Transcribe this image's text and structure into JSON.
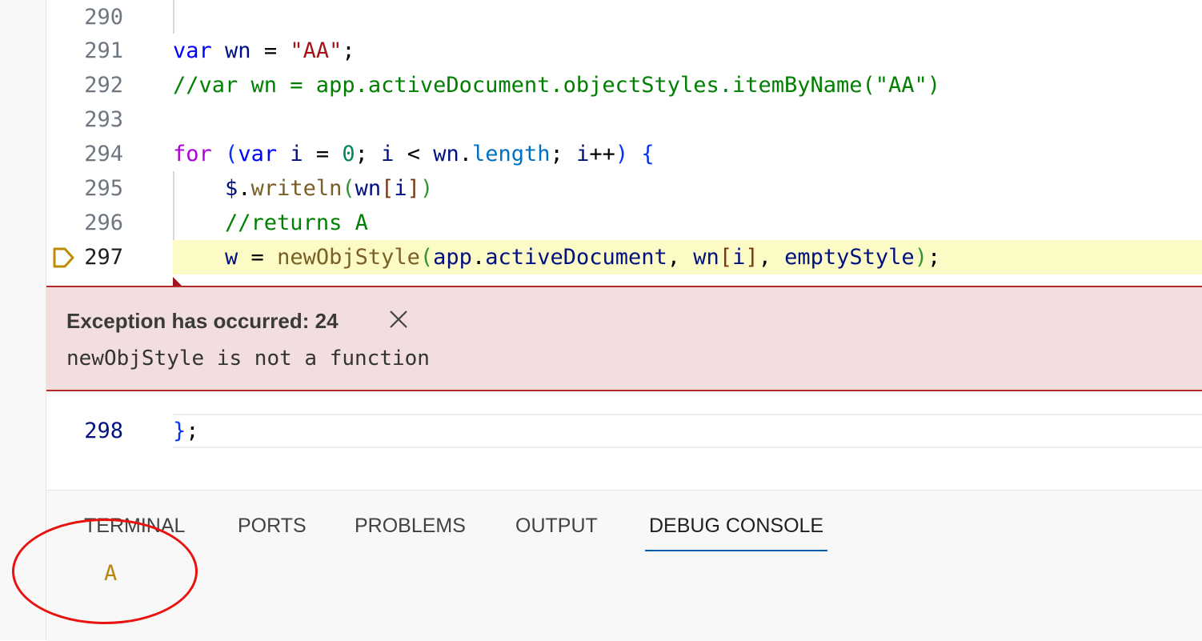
{
  "editor": {
    "lines": [
      {
        "number": "290",
        "tokens": []
      },
      {
        "number": "291",
        "tokens": [
          {
            "text": "var",
            "cls": "tk-kw"
          },
          {
            "text": " wn ",
            "cls": "tk-var"
          },
          {
            "text": "= ",
            "cls": "tk-op"
          },
          {
            "text": "\"AA\"",
            "cls": "tk-str"
          },
          {
            "text": ";",
            "cls": "tk-op"
          }
        ]
      },
      {
        "number": "292",
        "tokens": [
          {
            "text": "//var wn = app.activeDocument.objectStyles.itemByName(\"AA\")",
            "cls": "tk-com"
          }
        ]
      },
      {
        "number": "293",
        "tokens": []
      },
      {
        "number": "294",
        "tokens": [
          {
            "text": "for",
            "cls": "tk-ctl"
          },
          {
            "text": " ",
            "cls": "tk-op"
          },
          {
            "text": "(",
            "cls": "tk-p1"
          },
          {
            "text": "var",
            "cls": "tk-kw"
          },
          {
            "text": " i ",
            "cls": "tk-var"
          },
          {
            "text": "= ",
            "cls": "tk-op"
          },
          {
            "text": "0",
            "cls": "tk-num"
          },
          {
            "text": "; ",
            "cls": "tk-op"
          },
          {
            "text": "i",
            "cls": "tk-var"
          },
          {
            "text": " < ",
            "cls": "tk-op"
          },
          {
            "text": "wn",
            "cls": "tk-var"
          },
          {
            "text": ".",
            "cls": "tk-op"
          },
          {
            "text": "length",
            "cls": "tk-prop"
          },
          {
            "text": "; ",
            "cls": "tk-op"
          },
          {
            "text": "i",
            "cls": "tk-var"
          },
          {
            "text": "++",
            "cls": "tk-op"
          },
          {
            "text": ")",
            "cls": "tk-p1"
          },
          {
            "text": " ",
            "cls": "tk-op"
          },
          {
            "text": "{",
            "cls": "tk-p1"
          }
        ]
      },
      {
        "number": "295",
        "tokens": [
          {
            "text": "    ",
            "cls": "tk-op"
          },
          {
            "text": "$",
            "cls": "tk-var"
          },
          {
            "text": ".",
            "cls": "tk-op"
          },
          {
            "text": "writeln",
            "cls": "tk-fn"
          },
          {
            "text": "(",
            "cls": "tk-p2"
          },
          {
            "text": "wn",
            "cls": "tk-var"
          },
          {
            "text": "[",
            "cls": "tk-p3"
          },
          {
            "text": "i",
            "cls": "tk-var"
          },
          {
            "text": "]",
            "cls": "tk-p3"
          },
          {
            "text": ")",
            "cls": "tk-p2"
          }
        ]
      },
      {
        "number": "296",
        "tokens": [
          {
            "text": "    ",
            "cls": "tk-op"
          },
          {
            "text": "//returns A",
            "cls": "tk-com"
          }
        ]
      },
      {
        "number": "297",
        "current": true,
        "tokens": [
          {
            "text": "    ",
            "cls": "tk-op"
          },
          {
            "text": "w",
            "cls": "tk-var"
          },
          {
            "text": " = ",
            "cls": "tk-op"
          },
          {
            "text": "newObjStyle",
            "cls": "tk-fn"
          },
          {
            "text": "(",
            "cls": "tk-p2"
          },
          {
            "text": "app",
            "cls": "tk-var"
          },
          {
            "text": ".",
            "cls": "tk-op"
          },
          {
            "text": "activeDocument",
            "cls": "tk-var"
          },
          {
            "text": ", ",
            "cls": "tk-op"
          },
          {
            "text": "wn",
            "cls": "tk-var"
          },
          {
            "text": "[",
            "cls": "tk-p3"
          },
          {
            "text": "i",
            "cls": "tk-var"
          },
          {
            "text": "]",
            "cls": "tk-p3"
          },
          {
            "text": ", ",
            "cls": "tk-op"
          },
          {
            "text": "emptyStyle",
            "cls": "tk-var"
          },
          {
            "text": ")",
            "cls": "tk-p2"
          },
          {
            "text": ";",
            "cls": "tk-op"
          }
        ]
      }
    ],
    "after_line": {
      "number": "298",
      "tokens": [
        {
          "text": "}",
          "cls": "tk-p1"
        },
        {
          "text": ";",
          "cls": "tk-op"
        }
      ]
    }
  },
  "exception": {
    "title": "Exception has occurred: 24",
    "message": "newObjStyle is not a function"
  },
  "panel": {
    "tabs": [
      {
        "label": "TERMINAL",
        "active": false
      },
      {
        "label": "PORTS",
        "active": false
      },
      {
        "label": "PROBLEMS",
        "active": false
      },
      {
        "label": "OUTPUT",
        "active": false
      },
      {
        "label": "DEBUG CONSOLE",
        "active": true
      }
    ],
    "console_output": "A"
  },
  "colors": {
    "current_line_highlight": "#fdfbc5",
    "exception_background": "#f2dedf",
    "exception_border": "#b52a2a",
    "annotation_circle": "#e8120f",
    "active_tab_underline": "#005fb8"
  }
}
